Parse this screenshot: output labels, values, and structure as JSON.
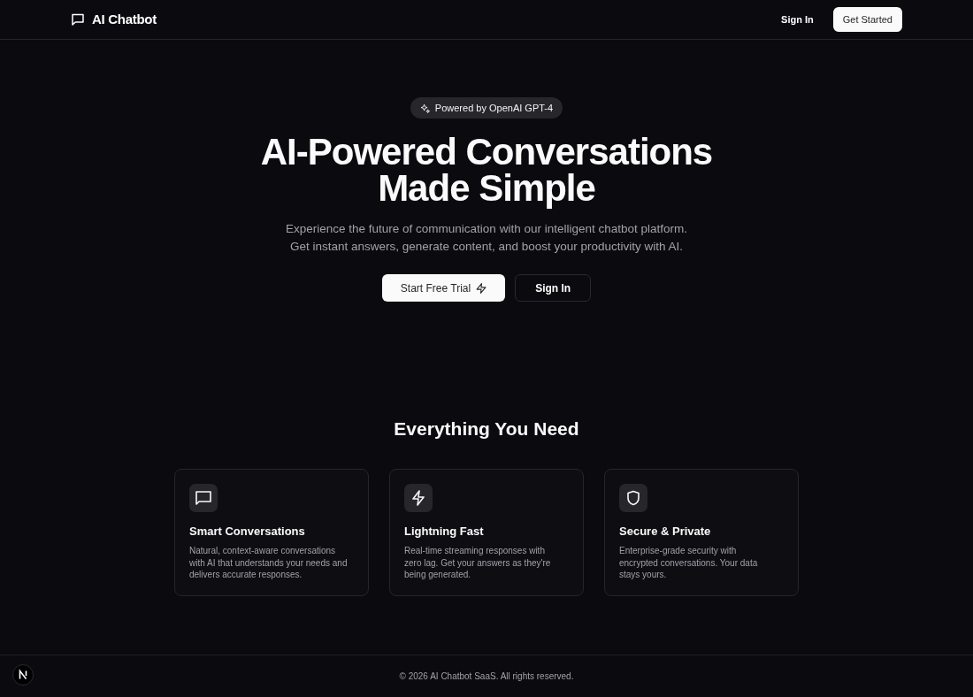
{
  "header": {
    "brand": "AI Chatbot",
    "links": [
      {
        "label": "Sign In",
        "kind": "link"
      },
      {
        "label": "Get Started",
        "kind": "button"
      }
    ]
  },
  "hero": {
    "badge": "Powered by OpenAI GPT-4",
    "title_lines": [
      "AI-Powered Conversations",
      "Made Simple"
    ],
    "subtitle_lines": [
      "Experience the future of communication with our intelligent chatbot platform.",
      "Get instant answers, generate content, and boost your productivity with AI."
    ],
    "buttons": [
      {
        "label": "Start Free Trial",
        "kind": "primary"
      },
      {
        "label": "Sign In",
        "kind": "outline"
      }
    ]
  },
  "features": {
    "heading": "Everything You Need",
    "cards": [
      {
        "title": "Smart Conversations",
        "text_lines": [
          "Natural, context-aware conversations",
          "with AI that understands your needs and",
          "delivers accurate responses."
        ]
      },
      {
        "title": "Lightning Fast",
        "text_lines": [
          "Real-time streaming responses with",
          "zero lag. Get your answers as they're",
          "being generated."
        ]
      },
      {
        "title": "Secure & Private",
        "text_lines": [
          "Enterprise-grade security with",
          "encrypted conversations. Your data",
          "stays yours."
        ]
      }
    ]
  },
  "footer": {
    "copyright": "© 2026 AI Chatbot SaaS. All rights reserved."
  }
}
